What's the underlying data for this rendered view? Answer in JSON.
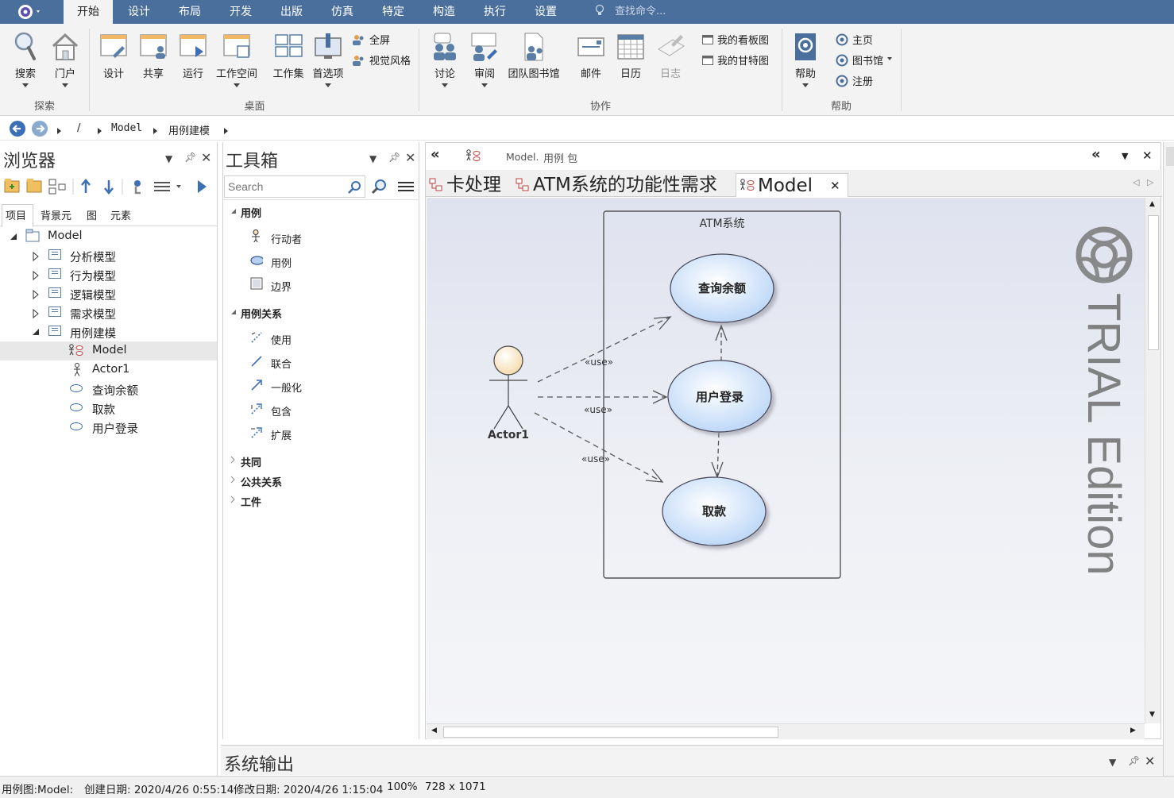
{
  "menubar": {
    "tabs": [
      "开始",
      "设计",
      "布局",
      "开发",
      "出版",
      "仿真",
      "特定",
      "构造",
      "执行",
      "设置"
    ],
    "active_tab": "开始",
    "find_placeholder": "查找命令..."
  },
  "ribbon": {
    "search": "搜索",
    "portal": "门户",
    "design": "设计",
    "share": "共享",
    "run": "运行",
    "workspace": "工作空间",
    "workset": "工作集",
    "preferences": "首选项",
    "fullscreen": "全屏",
    "visual_style": "视觉风格",
    "discuss": "讨论",
    "review": "审阅",
    "team_library": "团队图书馆",
    "mail": "邮件",
    "calendar": "日历",
    "journal": "日志",
    "my_kanban": "我的看板图",
    "my_gantt": "我的甘特图",
    "help": "帮助",
    "home": "主页",
    "library": "图书馆",
    "register": "注册",
    "group_explore": "探索",
    "group_desktop": "桌面",
    "group_collab": "协作",
    "group_help": "帮助"
  },
  "breadcrumb": {
    "root": "/",
    "item1": "Model",
    "item2": "用例建模"
  },
  "browser": {
    "title": "浏览器",
    "tabs": [
      "项目",
      "背景元",
      "图",
      "元素"
    ],
    "tree": {
      "root": "Model",
      "pkg1": "分析模型",
      "pkg2": "行为模型",
      "pkg3": "逻辑模型",
      "pkg4": "需求模型",
      "pkg5": "用例建模",
      "child_model": "Model",
      "child_actor": "Actor1",
      "child_uc1": "查询余额",
      "child_uc2": "取款",
      "child_uc3": "用户登录"
    }
  },
  "toolbox": {
    "title": "工具箱",
    "search_placeholder": "Search",
    "sec_usecase": "用例",
    "item_actor": "行动者",
    "item_usecase": "用例",
    "item_boundary": "边界",
    "sec_relations": "用例关系",
    "item_use": "使用",
    "item_assoc": "联合",
    "item_generalize": "一般化",
    "item_include": "包含",
    "item_extend": "扩展",
    "sec_common": "共同",
    "sec_common_rel": "公共关系",
    "sec_artifact": "工件"
  },
  "diagram": {
    "header_path": "Model.",
    "header_type": "用例 包",
    "tabs": [
      "卡处理",
      "ATM系统的功能性需求",
      "Model"
    ],
    "boundary_label": "ATM系统",
    "uc_query": "查询余额",
    "uc_login": "用户登录",
    "uc_withdraw": "取款",
    "actor_name": "Actor1",
    "use_label": "«use»",
    "watermark": "TRIAL Edition"
  },
  "output": {
    "title": "系统输出"
  },
  "status": {
    "diagram": "用例图:Model:",
    "created": "创建日期: 2020/4/26 0:55:14",
    "modified": "修改日期: 2020/4/26 1:15:04",
    "zoom": "100%",
    "size": "728 x 1071"
  },
  "colors": {
    "menubar": "#4a6f9c",
    "usecase_fill": "#d4e6fb",
    "actor_head": "#fbe7c6"
  }
}
